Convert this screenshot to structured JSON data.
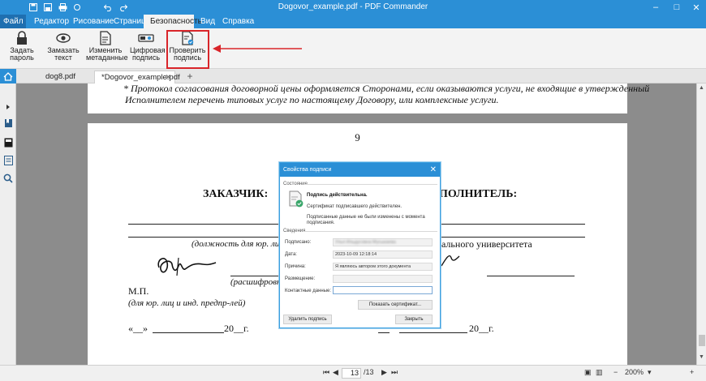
{
  "window": {
    "title": "Dogovor_example.pdf - PDF Commander"
  },
  "menu": {
    "tabs": [
      {
        "label": "Файл ▾"
      },
      {
        "label": "Редактор"
      },
      {
        "label": "Рисование"
      },
      {
        "label": "Страницы"
      },
      {
        "label": "Безопасность"
      },
      {
        "label": "Вид"
      },
      {
        "label": "Справка"
      }
    ],
    "active_tab": "Безопасность"
  },
  "ribbon": {
    "buttons": [
      {
        "line1": "Задать",
        "line2": "пароль",
        "icon": "lock-icon"
      },
      {
        "line1": "Замазать",
        "line2": "текст",
        "icon": "eye-icon"
      },
      {
        "line1": "Изменить",
        "line2": "метаданные",
        "icon": "document-edit-icon"
      },
      {
        "line1": "Цифровая",
        "line2": "подпись",
        "icon": "digital-signature-icon"
      },
      {
        "line1": "Проверить",
        "line2": "подпись",
        "icon": "verify-signature-icon"
      }
    ],
    "highlight_color": "#d9252a"
  },
  "doc_tabs": [
    {
      "label": "dog8.pdf"
    },
    {
      "label": "*Dogovor_example.pdf"
    }
  ],
  "document": {
    "page1_line1": "* Протокол согласования договорной цены оформляется Сторонами, если оказываются услуги, не входящие в утвержденный",
    "page1_line2": "Исполнителем перечень типовых услуг по настоящему Договору, или комплексные услуги.",
    "page_number": "9",
    "customer_heading": "ЗАКАЗЧИК:",
    "executor_heading": "ПОЛНИТЕЛЬ:",
    "position_label": "(должность для юр. ли",
    "university_fragment": "ального университета",
    "decoding_label": "(расшифровк",
    "stamp_label": "М.П.",
    "legal_note": "(для юр. лиц и инд. предпр-лей)",
    "date_left_prefix": "«__»",
    "date_left_year": "20__г.",
    "date_right_year": "20__г."
  },
  "dialog": {
    "title": "Свойства подписи",
    "status_section": "Состояние",
    "status_main": "Подпись действительна.",
    "status_line2": "Сертификат подписавшего действителен.",
    "status_line3": "Подписанные данные не были изменены с момента",
    "status_line4": "подписания.",
    "details_section": "Сведения",
    "fields": [
      {
        "label": "Подписано:",
        "value": "Улья Ильдусовна Мусыкаева",
        "blurred": true
      },
      {
        "label": "Дата:",
        "value": "2023-10-09 12:18:14"
      },
      {
        "label": "Причина:",
        "value": "Я являюсь автором этого документа"
      },
      {
        "label": "Размещение:",
        "value": ""
      },
      {
        "label": "Контактные данные:",
        "value": ""
      }
    ],
    "show_cert_button": "Показать сертификат...",
    "delete_button": "Удалить подпись",
    "close_button": "Закрыть"
  },
  "statusbar": {
    "current_page": "13",
    "total_pages": "/13",
    "zoom": "200%"
  },
  "colors": {
    "accent": "#2b8fd6",
    "highlight": "#d9252a"
  }
}
